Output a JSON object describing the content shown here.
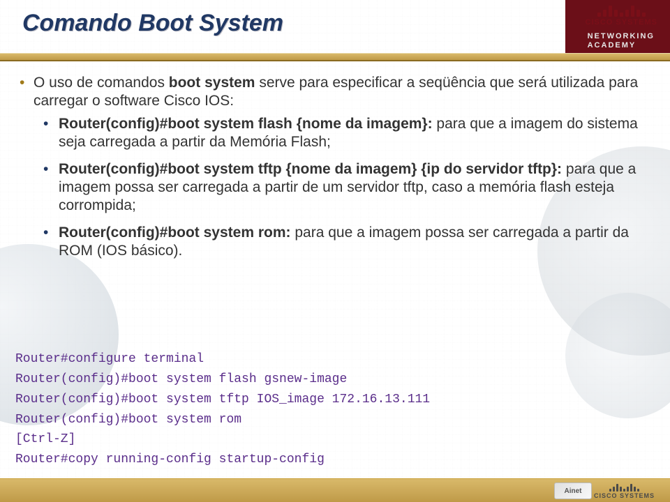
{
  "header": {
    "title": "Comando Boot System",
    "brand": "CISCO SYSTEMS",
    "academy_line1": "NETWORKING",
    "academy_line2": "ACADEMY"
  },
  "content": {
    "intro_pre": "O uso de comandos ",
    "intro_bold": "boot system",
    "intro_post": " serve para especificar a seqüência que será utilizada para carregar o software Cisco IOS:",
    "items": [
      {
        "cmd": "Router(config)#boot system flash {nome da imagem}:",
        "desc": " para que a imagem do sistema seja carregada a partir da Memória Flash;"
      },
      {
        "cmd": "Router(config)#boot system tftp {nome da imagem} {ip do servidor tftp}:",
        "desc": " para que a imagem possa ser carregada a partir de um servidor tftp, caso a memória flash esteja corrompida;"
      },
      {
        "cmd": "Router(config)#boot system rom:",
        "desc": " para que a imagem possa ser carregada a partir da ROM (IOS básico)."
      }
    ]
  },
  "terminal": {
    "lines": [
      "Router#configure terminal",
      "Router(config)#boot system flash gsnew-image",
      "Router(config)#boot system tftp IOS_image 172.16.13.111",
      "Router(config)#boot system rom",
      "[Ctrl-Z]",
      "Router#copy running-config startup-config"
    ]
  },
  "footer": {
    "ainet": "Ainet",
    "cisco": "CISCO SYSTEMS"
  }
}
